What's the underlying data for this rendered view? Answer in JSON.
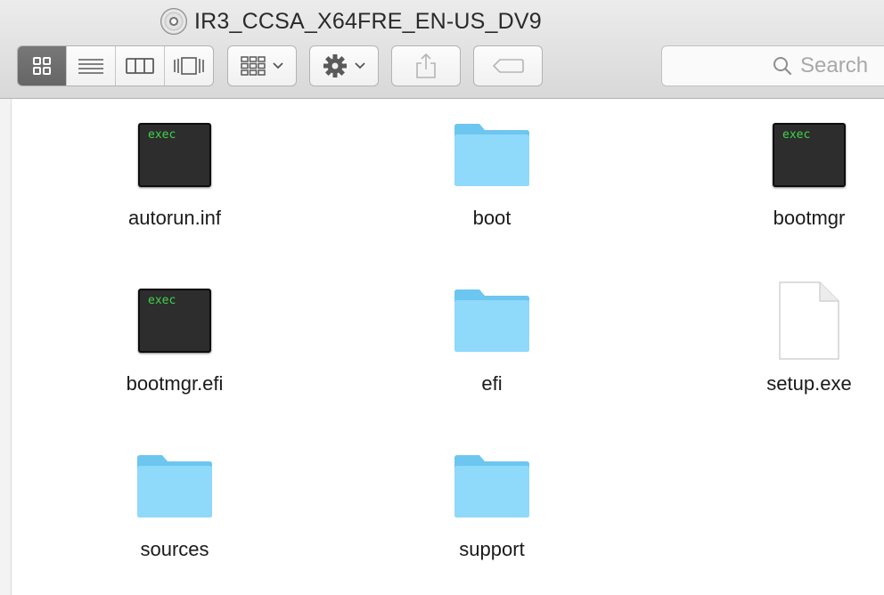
{
  "window": {
    "title": "IR3_CCSA_X64FRE_EN-US_DV9"
  },
  "toolbar": {
    "views": [
      {
        "name": "icon-view",
        "active": true
      },
      {
        "name": "list-view",
        "active": false
      },
      {
        "name": "column-view",
        "active": false
      },
      {
        "name": "cover-flow-view",
        "active": false
      }
    ],
    "search_placeholder": "Search"
  },
  "files": [
    {
      "label": "autorun.inf",
      "kind": "exec",
      "badge": "exec"
    },
    {
      "label": "boot",
      "kind": "folder"
    },
    {
      "label": "bootmgr",
      "kind": "exec",
      "badge": "exec"
    },
    {
      "label": "bootmgr.efi",
      "kind": "exec",
      "badge": "exec"
    },
    {
      "label": "efi",
      "kind": "folder"
    },
    {
      "label": "setup.exe",
      "kind": "document"
    },
    {
      "label": "sources",
      "kind": "folder"
    },
    {
      "label": "support",
      "kind": "folder"
    }
  ],
  "colors": {
    "folder": "#7fd0f5",
    "exec_text": "#3fd44a",
    "active_segment": "#6e6e6e"
  }
}
